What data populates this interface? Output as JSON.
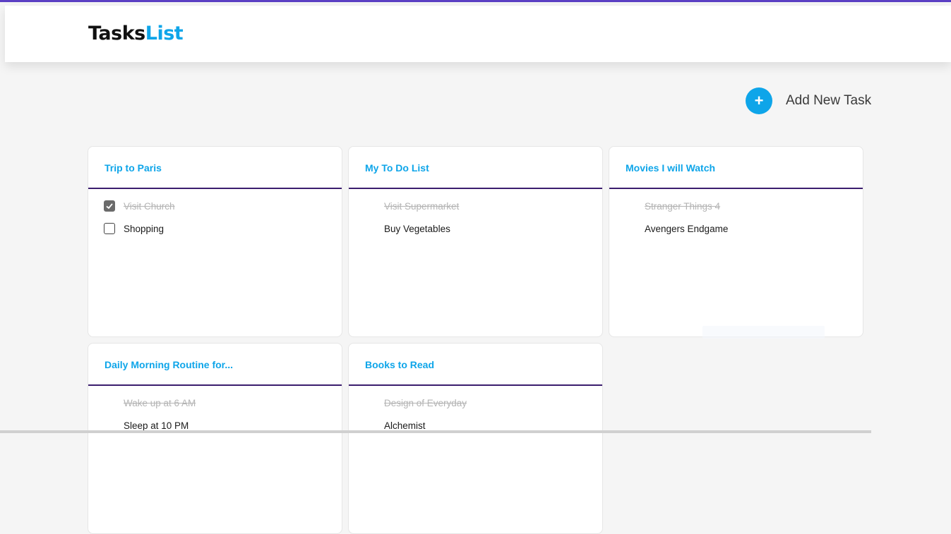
{
  "app": {
    "logo_part1": "Tasks",
    "logo_part2": "List",
    "accent_color": "#0ea5e9",
    "divider_color": "#3b1d6e"
  },
  "toolbar": {
    "add_icon": "plus-icon",
    "add_icon_glyph": "+",
    "add_label": "Add New Task"
  },
  "lists": [
    {
      "title": "Trip to Paris",
      "tasks": [
        {
          "text": "Visit Church",
          "done": true
        },
        {
          "text": "Shopping",
          "done": false
        }
      ]
    },
    {
      "title": "My To Do List",
      "tasks": [
        {
          "text": "Visit Supermarket",
          "done": true
        },
        {
          "text": "Buy Vegetables",
          "done": false
        }
      ]
    },
    {
      "title": "Movies I will Watch",
      "tasks": [
        {
          "text": "Stranger Things 4",
          "done": true
        },
        {
          "text": "Avengers Endgame",
          "done": false
        }
      ]
    },
    {
      "title": "Daily Morning Routine for...",
      "tasks": [
        {
          "text": "Wake up at 6 AM",
          "done": true
        },
        {
          "text": "Sleep at 10 PM",
          "done": false
        }
      ]
    },
    {
      "title": "Books to Read",
      "tasks": [
        {
          "text": "Design of Everyday",
          "done": true
        },
        {
          "text": "Alchemist",
          "done": false
        }
      ]
    }
  ]
}
